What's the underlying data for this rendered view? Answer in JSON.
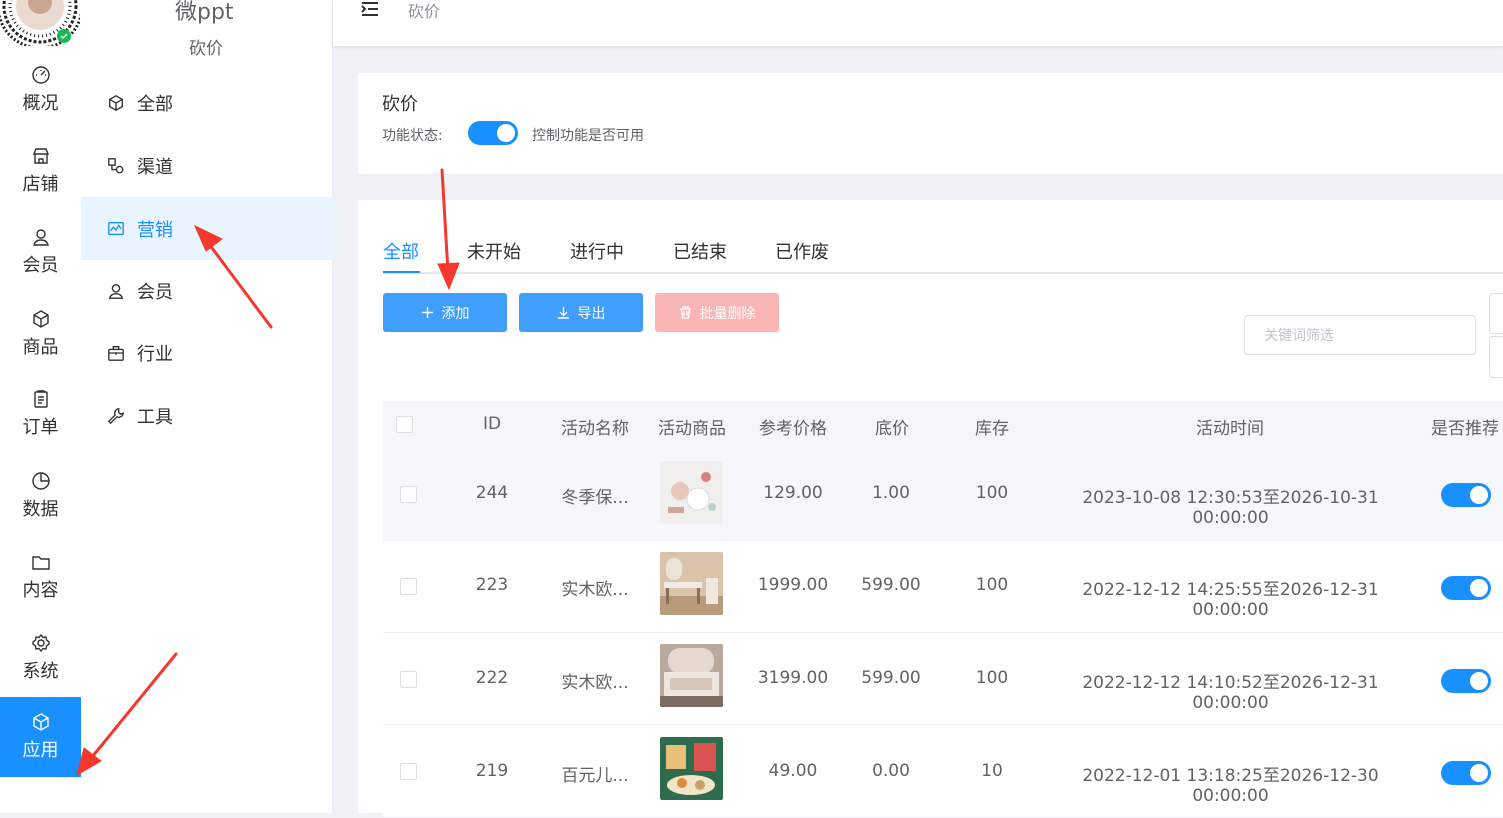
{
  "app": {
    "name": "微ppt",
    "subtitle": "砍价"
  },
  "rail": {
    "items": [
      {
        "label": "概况",
        "icon": "dashboard-icon"
      },
      {
        "label": "店铺",
        "icon": "shop-icon"
      },
      {
        "label": "会员",
        "icon": "user-icon"
      },
      {
        "label": "商品",
        "icon": "box-icon"
      },
      {
        "label": "订单",
        "icon": "clipboard-icon"
      },
      {
        "label": "数据",
        "icon": "pie-icon"
      },
      {
        "label": "内容",
        "icon": "folder-icon"
      },
      {
        "label": "系统",
        "icon": "gear-icon"
      },
      {
        "label": "应用",
        "icon": "cube-icon"
      }
    ],
    "active": "应用"
  },
  "submenu": {
    "items": [
      {
        "label": "全部",
        "icon": "cube-icon"
      },
      {
        "label": "渠道",
        "icon": "channel-icon"
      },
      {
        "label": "营销",
        "icon": "chart-icon"
      },
      {
        "label": "会员",
        "icon": "user-icon"
      },
      {
        "label": "行业",
        "icon": "briefcase-icon"
      },
      {
        "label": "工具",
        "icon": "wrench-icon"
      }
    ],
    "active": "营销"
  },
  "header": {
    "breadcrumb": "砍价"
  },
  "feature": {
    "title": "砍价",
    "status_label": "功能状态:",
    "status_on": true,
    "status_desc": "控制功能是否可用"
  },
  "tabs": [
    "全部",
    "未开始",
    "进行中",
    "已结束",
    "已作废"
  ],
  "active_tab": "全部",
  "toolbar": {
    "add_label": "添加",
    "export_label": "导出",
    "batch_delete_label": "批量删除",
    "search_placeholder": "关键词筛选"
  },
  "table": {
    "columns": [
      "ID",
      "活动名称",
      "活动商品",
      "参考价格",
      "底价",
      "库存",
      "活动时间",
      "是否推荐"
    ],
    "rows": [
      {
        "id": "244",
        "name": "冬季保...",
        "price": "129.00",
        "floor": "1.00",
        "stock": "100",
        "time": "2023-10-08 12:30:53至2026-10-31 00:00:00",
        "recommended": true
      },
      {
        "id": "223",
        "name": "实木欧...",
        "price": "1999.00",
        "floor": "599.00",
        "stock": "100",
        "time": "2022-12-12 14:25:55至2026-12-31 00:00:00",
        "recommended": true
      },
      {
        "id": "222",
        "name": "实木欧...",
        "price": "3199.00",
        "floor": "599.00",
        "stock": "100",
        "time": "2022-12-12 14:10:52至2026-12-31 00:00:00",
        "recommended": true
      },
      {
        "id": "219",
        "name": "百元儿...",
        "price": "49.00",
        "floor": "0.00",
        "stock": "10",
        "time": "2022-12-01 13:18:25至2026-12-30 00:00:00",
        "recommended": true
      }
    ]
  },
  "colors": {
    "primary": "#1890ff",
    "button": "#409eff",
    "danger_disabled": "#fab6b6",
    "arrow": "#f5382d"
  }
}
